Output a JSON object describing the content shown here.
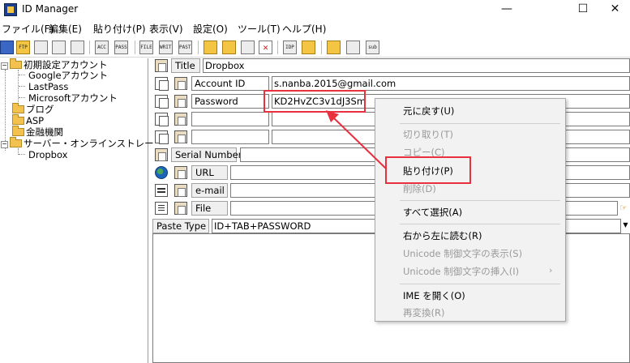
{
  "window": {
    "title": "ID Manager",
    "minimize": "—",
    "maximize": "☐",
    "close": "✕"
  },
  "menu": [
    "ファイル(F)",
    "編集(E)",
    "貼り付け(P)",
    "表示(V)",
    "設定(O)",
    "ツール(T)",
    "ヘルプ(H)"
  ],
  "toolbar": {
    "icons": [
      "save-icon",
      "ftp-upload-icon",
      "xml-export-icon",
      "xml-import-icon",
      "gear-icon",
      "acc-icon",
      "pass-icon",
      "file-icon",
      "write-icon",
      "paste-icon",
      "new-folder-icon",
      "new-item-icon",
      "new-doc-icon",
      "delete-icon",
      "idp-icon",
      "robot-icon",
      "lock-icon",
      "window-icon",
      "sub-icon"
    ],
    "labels": {
      "ftp": "FTP",
      "acc": "ACC",
      "pass": "PASS",
      "file": "FILE",
      "write": "WRITE",
      "paste": "PASTE",
      "sub": "sub",
      "idp": "IDP",
      "delete": "✕"
    }
  },
  "tree": {
    "items": [
      {
        "label": "初期設定アカウント",
        "type": "folder",
        "expander": "−"
      },
      {
        "label": "Googleアカウント",
        "type": "leaf"
      },
      {
        "label": "LastPass",
        "type": "leaf"
      },
      {
        "label": "Microsoftアカウント",
        "type": "leaf"
      },
      {
        "label": "ブログ",
        "type": "folder"
      },
      {
        "label": "ASP",
        "type": "folder"
      },
      {
        "label": "金融機関",
        "type": "folder"
      },
      {
        "label": "サーバー・オンラインストレー",
        "type": "folder",
        "expander": "−"
      },
      {
        "label": "Dropbox",
        "type": "leaf",
        "selected": true
      }
    ]
  },
  "form": {
    "title_label": "Title",
    "title_value": "Dropbox",
    "account_label": "Account ID",
    "account_value": "s.nanba.2015@gmail.com",
    "password_label": "Password",
    "password_value": "KD2HvZC3v1dJ3Sm",
    "custom_rows": [
      "",
      ""
    ],
    "serial_label": "Serial Number",
    "serial_value": "",
    "url_label": "URL",
    "url_value": "",
    "email_label": "e-mail",
    "email_value": "",
    "file_label": "File",
    "file_value": "",
    "paste_type_label": "Paste Type",
    "paste_type_value": "ID+TAB+PASSWORD",
    "combo_arrow": "▼",
    "hand": "☞",
    "notes": ""
  },
  "context_menu": {
    "items": [
      {
        "label": "元に戻す(U)",
        "enabled": true
      },
      {
        "label": "切り取り(T)",
        "enabled": false
      },
      {
        "label": "コピー(C)",
        "enabled": false
      },
      {
        "label": "貼り付け(P)",
        "enabled": true
      },
      {
        "label": "削除(D)",
        "enabled": false
      },
      {
        "label": "すべて選択(A)",
        "enabled": true
      },
      {
        "label": "右から左に読む(R)",
        "enabled": true
      },
      {
        "label": "Unicode 制御文字の表示(S)",
        "enabled": false
      },
      {
        "label": "Unicode 制御文字の挿入(I)",
        "enabled": false,
        "submenu": "›"
      },
      {
        "label": "IME を開く(O)",
        "enabled": true
      },
      {
        "label": "再変換(R)",
        "enabled": false
      }
    ]
  },
  "colors": {
    "highlight": "#e8303f",
    "folder": "#f2c14e",
    "menu_bg": "#f2f2f2"
  }
}
